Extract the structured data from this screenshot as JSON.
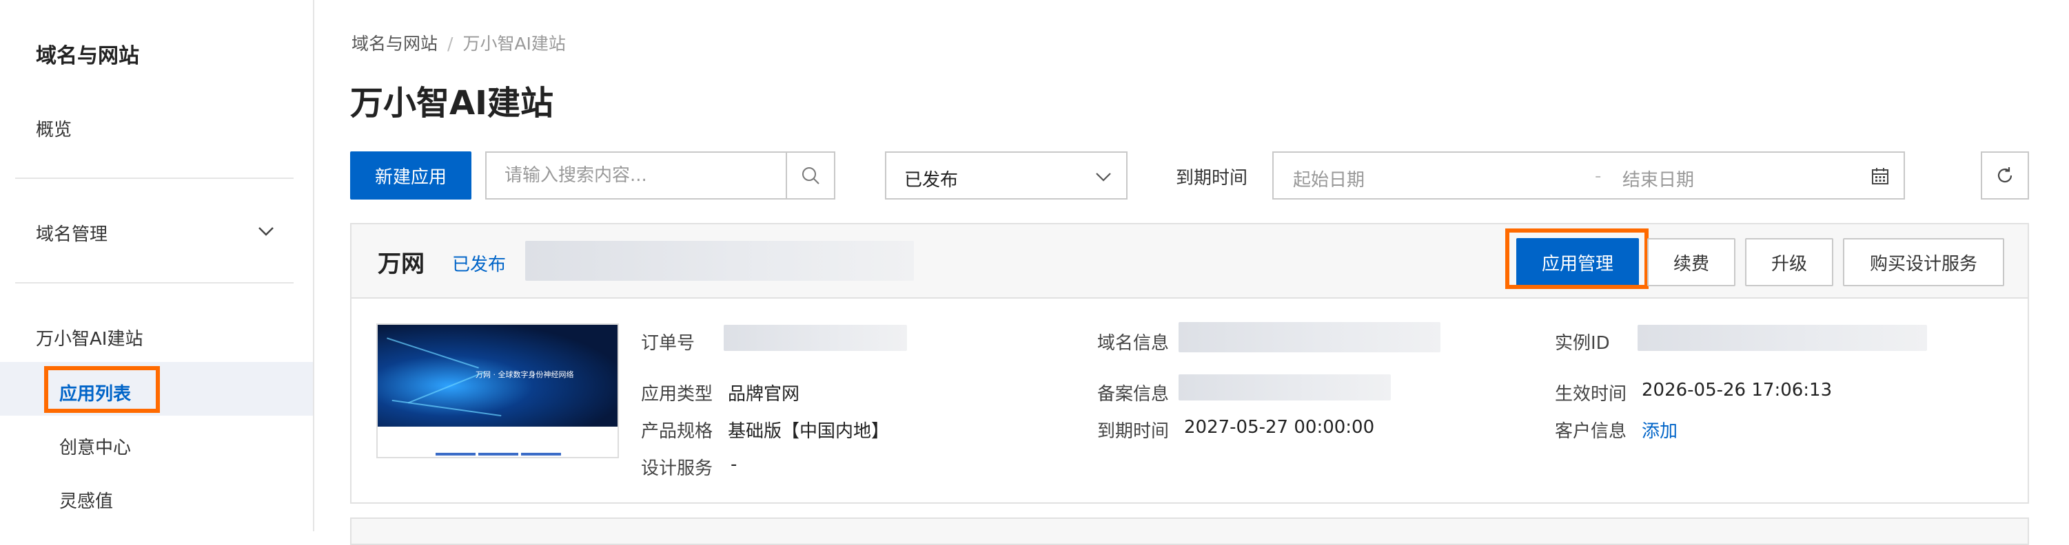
{
  "sidebar": {
    "title": "域名与网站",
    "overview": "概览",
    "domain_mgmt": "域名管理",
    "ai_site": "万小智AI建站",
    "sub_items": [
      "应用列表",
      "创意中心",
      "灵感值"
    ]
  },
  "breadcrumb": {
    "root": "域名与网站",
    "separator": "/",
    "current": "万小智AI建站"
  },
  "page_title": "万小智AI建站",
  "toolbar": {
    "new_app": "新建应用",
    "search_placeholder": "请输入搜索内容...",
    "status_select": "已发布",
    "expire_label": "到期时间",
    "start_date": "起始日期",
    "date_separator": "-",
    "end_date": "结束日期"
  },
  "card": {
    "name": "万网",
    "status": "已发布",
    "actions": {
      "manage": "应用管理",
      "renew": "续费",
      "upgrade": "升级",
      "design": "购买设计服务"
    },
    "thumbnail_text": "万网 · 全球数字身份神经网络",
    "fields": {
      "order_no_label": "订单号",
      "app_type_label": "应用类型",
      "app_type_value": "品牌官网",
      "spec_label": "产品规格",
      "spec_value": "基础版【中国内地】",
      "design_label": "设计服务",
      "design_value": "-",
      "domain_label": "域名信息",
      "icp_label": "备案信息",
      "expire_label": "到期时间",
      "expire_value": "2027-05-27 00:00:00",
      "instance_label": "实例ID",
      "effective_label": "生效时间",
      "effective_value": "2026-05-26 17:06:13",
      "customer_label": "客户信息",
      "customer_action": "添加"
    }
  },
  "colors": {
    "accent": "#0064c8",
    "highlight": "#ff6a00"
  }
}
